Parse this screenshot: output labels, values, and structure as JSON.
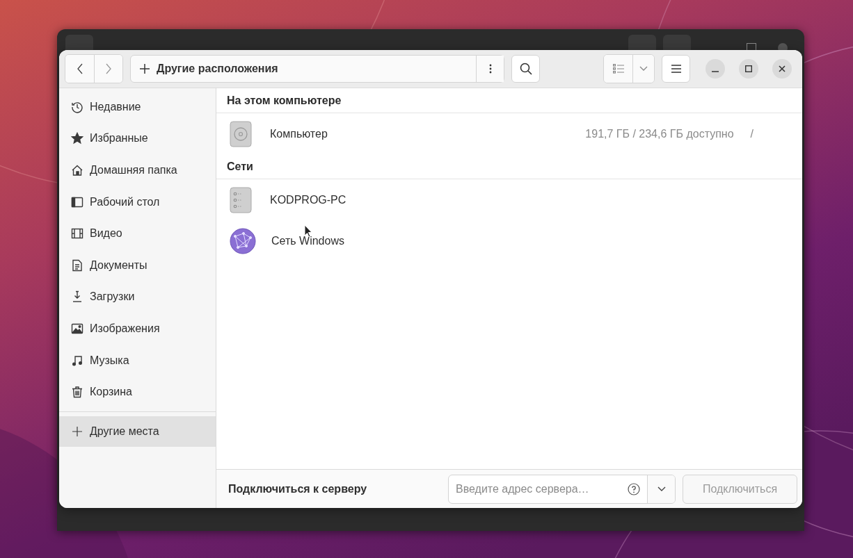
{
  "toolbar": {
    "location": "Другие расположения"
  },
  "sidebar": {
    "items": [
      {
        "kind": "recent",
        "label": "Недавние",
        "selected": false
      },
      {
        "kind": "starred",
        "label": "Избранные",
        "selected": false
      },
      {
        "kind": "home",
        "label": "Домашняя папка",
        "selected": false
      },
      {
        "kind": "desktop",
        "label": "Рабочий стол",
        "selected": false
      },
      {
        "kind": "videos",
        "label": "Видео",
        "selected": false
      },
      {
        "kind": "documents",
        "label": "Документы",
        "selected": false
      },
      {
        "kind": "downloads",
        "label": "Загрузки",
        "selected": false
      },
      {
        "kind": "pictures",
        "label": "Изображения",
        "selected": false
      },
      {
        "kind": "music",
        "label": "Музыка",
        "selected": false
      },
      {
        "kind": "trash",
        "label": "Корзина",
        "selected": false
      },
      {
        "kind": "other",
        "label": "Другие места",
        "selected": true
      }
    ]
  },
  "sections": [
    {
      "title": "На этом компьютере",
      "items": [
        {
          "kind": "drive",
          "name": "Компьютер",
          "space": "191,7 ГБ / 234,6 ГБ доступно",
          "mount": "/"
        }
      ]
    },
    {
      "title": "Сети",
      "items": [
        {
          "kind": "server",
          "name": "KODPROG-PC"
        },
        {
          "kind": "network",
          "name": "Сеть Windows"
        }
      ]
    }
  ],
  "connect": {
    "label": "Подключиться к серверу",
    "placeholder": "Введите адрес сервера…",
    "button": "Подключиться",
    "button_disabled": true
  }
}
